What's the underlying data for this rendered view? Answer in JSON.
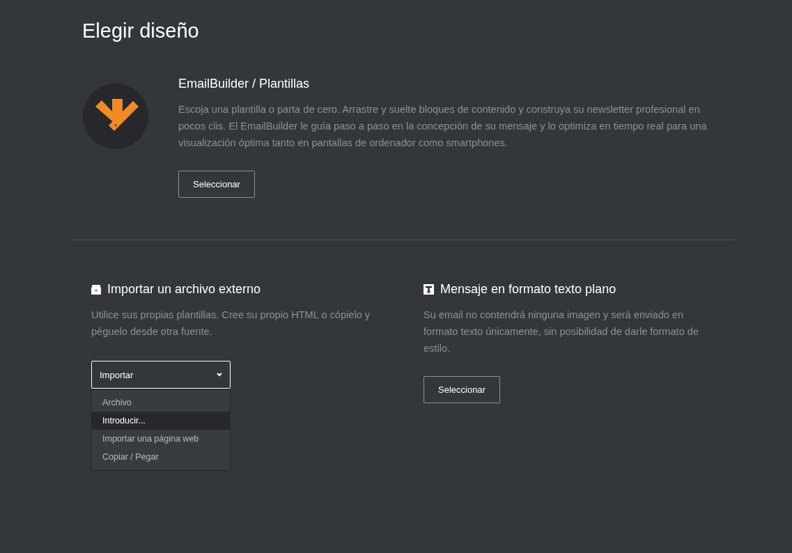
{
  "page": {
    "title": "Elegir diseño"
  },
  "builder": {
    "title": "EmailBuilder / Plantillas",
    "description": "Escoja una plantilla o parta de cero. Arrastre y suelte bloques de contenido y construya su newsletter profesional en pocos clis. El EmailBuilder le guía paso a paso en la concepción de su mensaje y lo optimiza en tiempo real para una visualización óptima tanto en pantallas de ordenador como smartphones.",
    "button": "Seleccionar"
  },
  "import": {
    "title": "Importar un archivo externo",
    "description": "Utilice sus propias plantillas. Cree su propio HTML o cópielo y péguelo desde otra fuente.",
    "dropdown": {
      "value": "Importar",
      "expanded": true,
      "options": [
        {
          "label": "Archivo",
          "selected": false
        },
        {
          "label": "Introducir...",
          "selected": true
        },
        {
          "label": "Importar una página web",
          "selected": false
        },
        {
          "label": "Copiar / Pegar",
          "selected": false
        }
      ]
    }
  },
  "plain_text": {
    "title": "Mensaje en formato texto plano",
    "description": "Su email no contendrá ninguna imagen y será enviado en formato texto únicamente, sin posibilidad de darle formato de estilo.",
    "button": "Seleccionar"
  }
}
